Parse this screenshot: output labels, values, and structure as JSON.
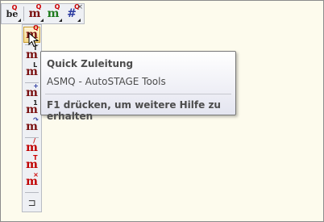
{
  "toolbar": {
    "buttons": [
      {
        "name": "be-button",
        "text": "be",
        "sup": "Q"
      },
      {
        "name": "mq-button",
        "text": "m",
        "sup": "Q"
      },
      {
        "name": "mq-green-button",
        "text": "m",
        "sup": "Q"
      },
      {
        "name": "hash-button",
        "text": "#",
        "sup": "Q"
      }
    ],
    "close_glyph": "×"
  },
  "vertical_toolbar": {
    "items": [
      {
        "text": "m",
        "sup": "Q"
      },
      {
        "text": "m",
        "sup": "T"
      },
      {
        "text": "m",
        "sup": "L"
      },
      {
        "text": "m",
        "sup": "+"
      },
      {
        "text": "m",
        "sup": "1"
      },
      {
        "text": "m",
        "sup": "↷"
      },
      {
        "text": "m",
        "sup": "/"
      },
      {
        "text": "m",
        "sup": "T"
      },
      {
        "text": "m",
        "sup": "×"
      },
      {
        "text": "⊐",
        "sup": ""
      }
    ]
  },
  "tooltip": {
    "title": "Quick Zuleitung",
    "subtitle": "ASMQ - AutoSTAGE Tools",
    "help": "F1 drücken, um weitere Hilfe zu erhalten"
  },
  "colors": {
    "background": "#fdfbed",
    "icon_red": "#c00000",
    "icon_dark": "#7a1010"
  }
}
